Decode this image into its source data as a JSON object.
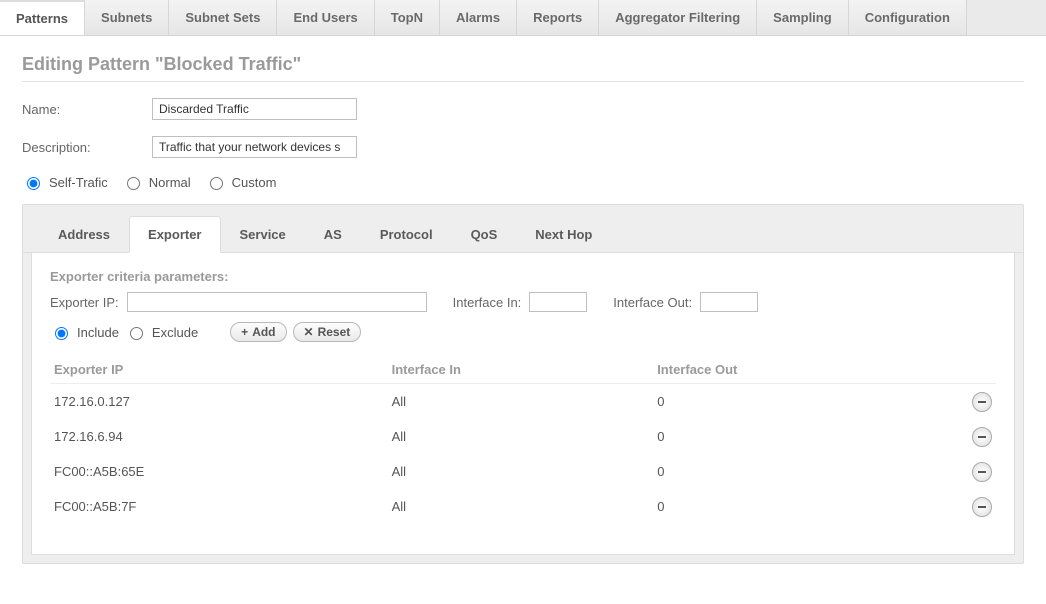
{
  "topnav": {
    "tabs": [
      {
        "label": "Patterns",
        "active": true
      },
      {
        "label": "Subnets"
      },
      {
        "label": "Subnet Sets"
      },
      {
        "label": "End Users"
      },
      {
        "label": "TopN"
      },
      {
        "label": "Alarms"
      },
      {
        "label": "Reports"
      },
      {
        "label": "Aggregator Filtering"
      },
      {
        "label": "Sampling"
      },
      {
        "label": "Configuration"
      }
    ]
  },
  "page": {
    "title": "Editing Pattern \"Blocked Traffic\"",
    "name_label": "Name:",
    "name_value": "Discarded Traffic",
    "description_label": "Description:",
    "description_value": "Traffic that your network devices s"
  },
  "traffic_type": {
    "options": [
      "Self-Trafic",
      "Normal",
      "Custom"
    ],
    "selected": "Self-Trafic"
  },
  "subtabs": {
    "items": [
      {
        "label": "Address"
      },
      {
        "label": "Exporter",
        "active": true
      },
      {
        "label": "Service"
      },
      {
        "label": "AS"
      },
      {
        "label": "Protocol"
      },
      {
        "label": "QoS"
      },
      {
        "label": "Next Hop"
      }
    ]
  },
  "exporter": {
    "section_title": "Exporter criteria parameters:",
    "exporter_ip_label": "Exporter IP:",
    "exporter_ip_value": "",
    "interface_in_label": "Interface In:",
    "interface_in_value": "",
    "interface_out_label": "Interface Out:",
    "interface_out_value": "",
    "include_label": "Include",
    "exclude_label": "Exclude",
    "include_selected": true,
    "add_label": "Add",
    "reset_label": "Reset",
    "columns": {
      "c1": "Exporter IP",
      "c2": "Interface In",
      "c3": "Interface Out"
    },
    "rows": [
      {
        "ip": "172.16.0.127",
        "in": "All",
        "out": "0"
      },
      {
        "ip": "172.16.6.94",
        "in": "All",
        "out": "0"
      },
      {
        "ip": "FC00::A5B:65E",
        "in": "All",
        "out": "0"
      },
      {
        "ip": "FC00::A5B:7F",
        "in": "All",
        "out": "0"
      }
    ]
  }
}
